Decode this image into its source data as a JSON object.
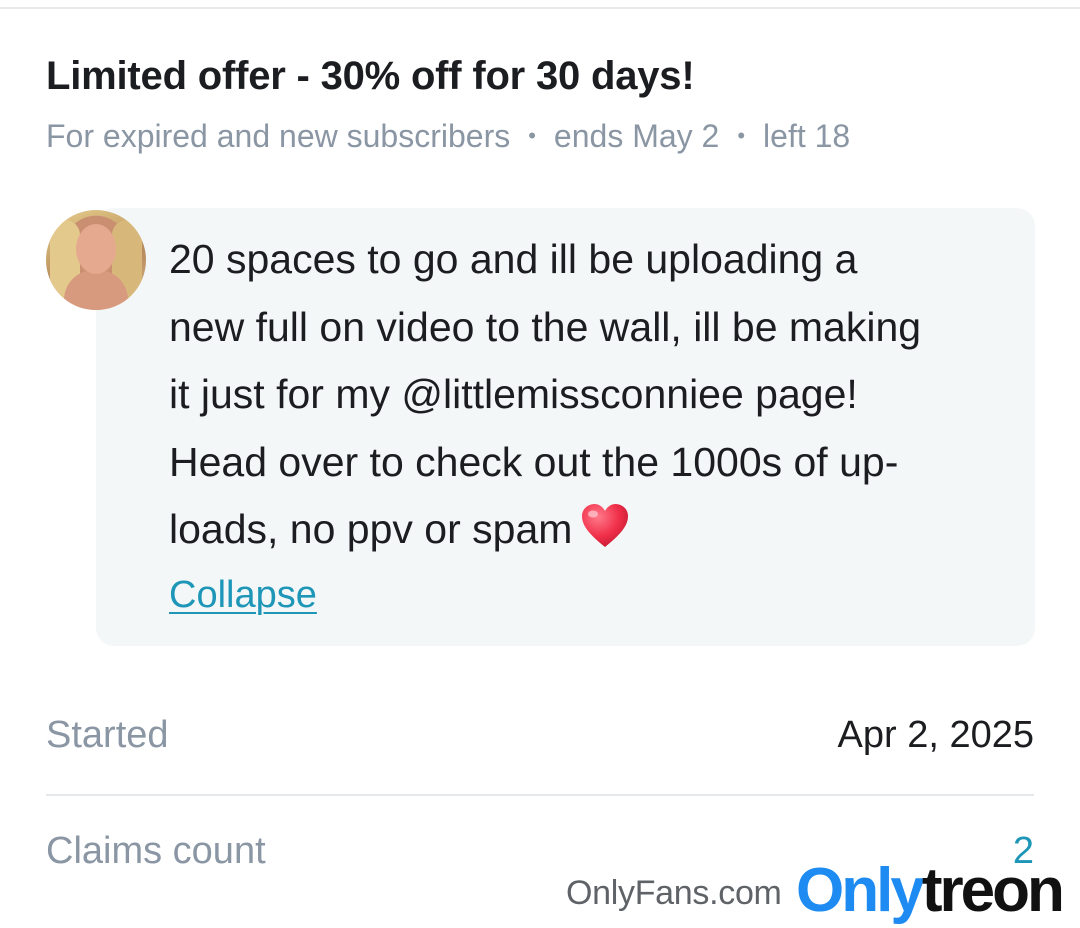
{
  "offer": {
    "title": "Limited offer - 30% off for 30 days!",
    "audience": "For expired and new subscribers",
    "ends": "ends May 2",
    "left": "left 18",
    "separator": "•"
  },
  "message": {
    "text": "20 spaces to go and ill be uploading a new full on video to the wall, ill be making it just for my @littlemissconniee page! Head over to check out the 1000s of uploads, no ppv or spam",
    "line1": "20 spaces to go and ill be uploading a",
    "line2": "new full on video to the wall, ill be making",
    "line3": "it just for my @littlemissconniee page!",
    "line4": "Head over to check out the 1000s of up-",
    "line5": "loads, no ppv or spam",
    "emoji_icon": "red-heart-icon",
    "collapse_label": "Collapse"
  },
  "details": {
    "started_label": "Started",
    "started_value": "Apr 2, 2025",
    "claims_label": "Claims count",
    "claims_value": "2"
  },
  "watermark": {
    "site": "OnlyFans.com",
    "logo_part1": "Only",
    "logo_part2": "treon"
  },
  "colors": {
    "accent": "#1e96b8",
    "muted_text": "#8a96a3",
    "primary_text": "#1c1d20",
    "message_bg": "#f4f7f8",
    "logo_blue": "#1d8bf1"
  }
}
